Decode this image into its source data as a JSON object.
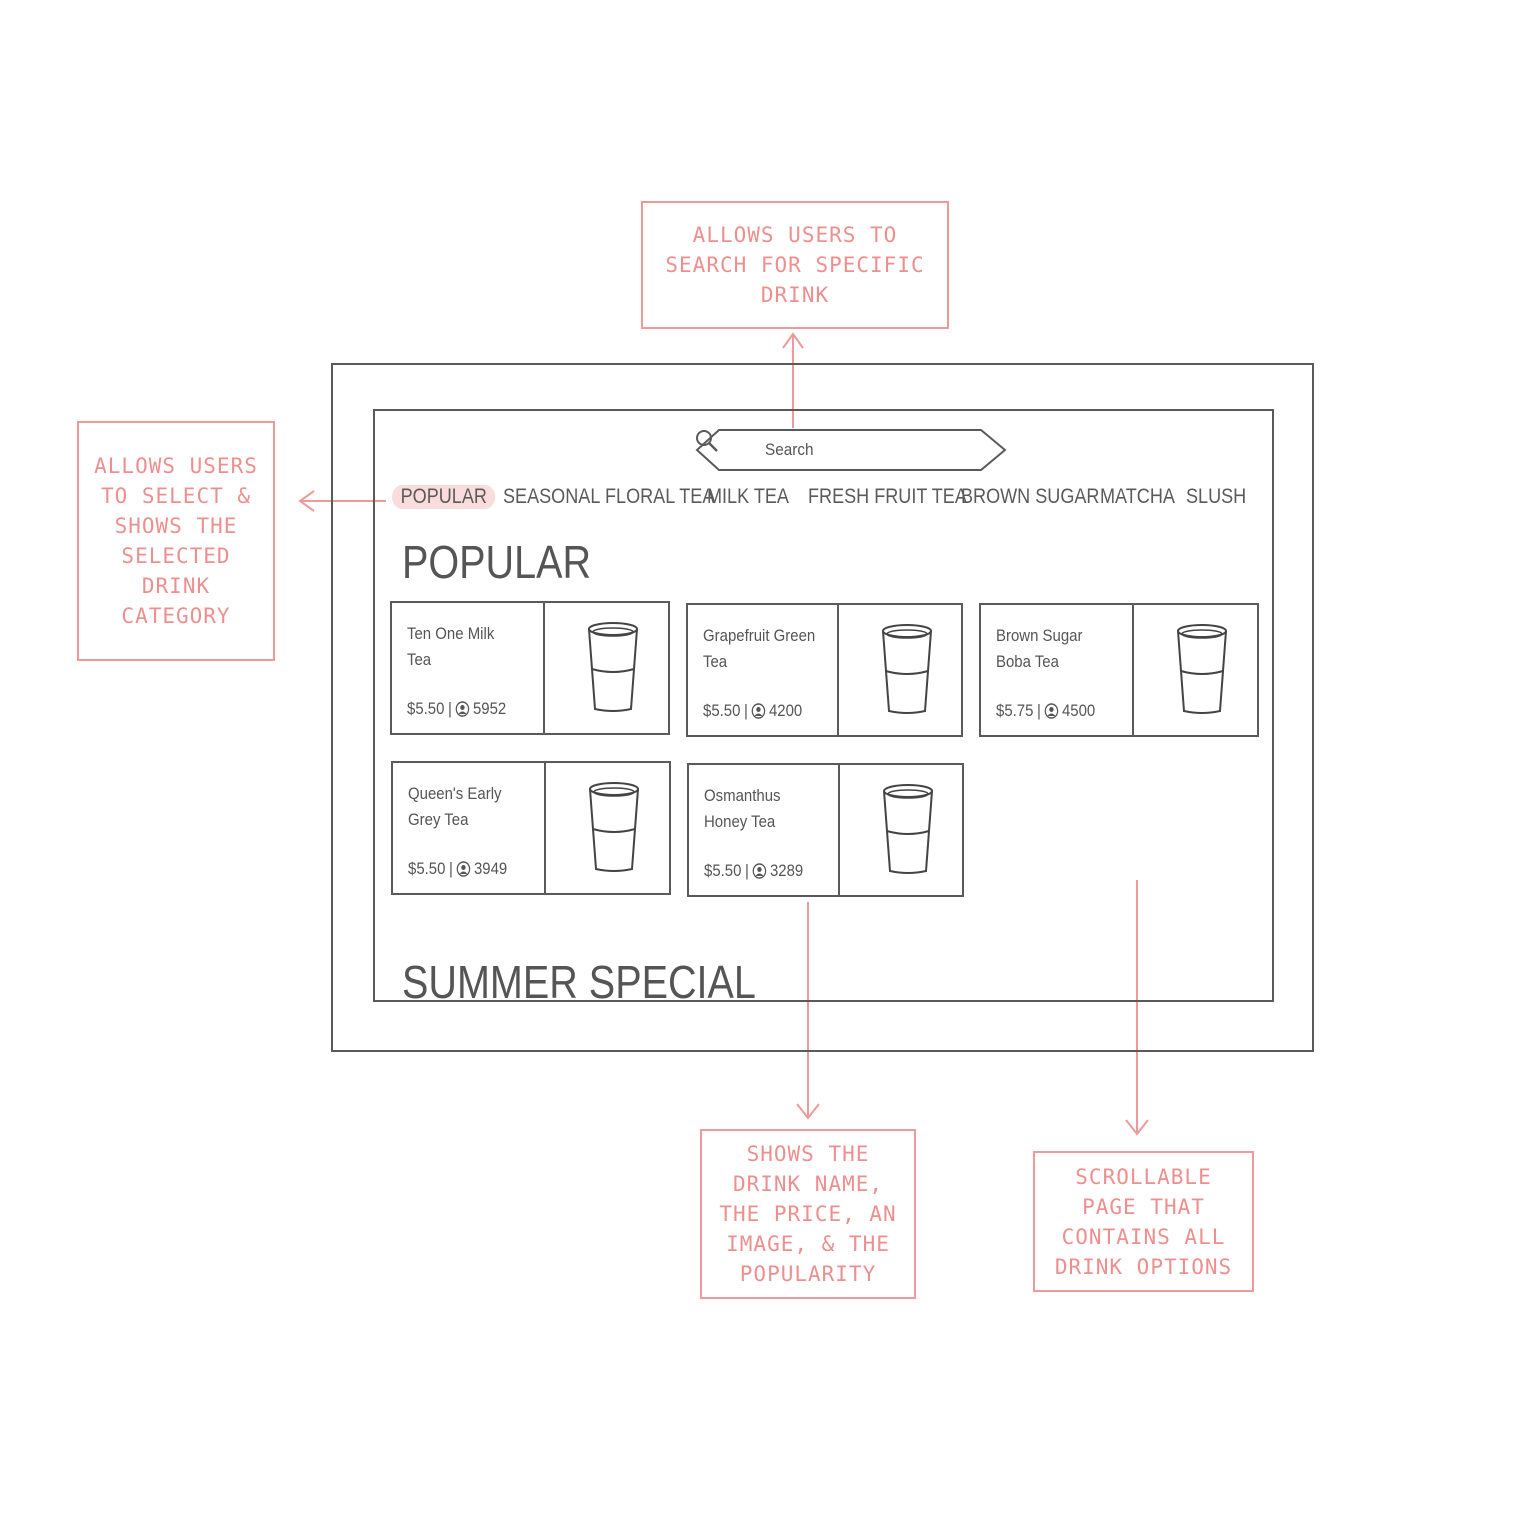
{
  "search": {
    "placeholder": "Search"
  },
  "tabs": [
    {
      "label": "POPULAR",
      "active": true
    },
    {
      "label": "SEASONAL",
      "active": false
    },
    {
      "label": "FLORAL TEA",
      "active": false
    },
    {
      "label": "MILK TEA",
      "active": false
    },
    {
      "label": "FRESH FRUIT TEA",
      "active": false
    },
    {
      "label": "BROWN SUGAR",
      "active": false
    },
    {
      "label": "MATCHA",
      "active": false
    },
    {
      "label": "SLUSH",
      "active": false
    }
  ],
  "sections": {
    "popular": "POPULAR",
    "summer": "SUMMER SPECIAL"
  },
  "drinks": [
    {
      "name": "Ten One Milk Tea",
      "price": "$5.50",
      "popularity": "5952"
    },
    {
      "name": "Grapefruit Green Tea",
      "price": "$5.50",
      "popularity": "4200"
    },
    {
      "name": "Brown Sugar Boba Tea",
      "price": "$5.75",
      "popularity": "4500"
    },
    {
      "name": "Queen's Early Grey Tea",
      "price": "$5.50",
      "popularity": "3949"
    },
    {
      "name": "Osmanthus Honey Tea",
      "price": "$5.50",
      "popularity": "3289"
    }
  ],
  "annotations": {
    "search": "Allows users to search for specific drink",
    "category": "Allows users to select & shows the selected drink category",
    "card": "Shows the drink name, the price, an image, & the popularity",
    "scroll": "Scrollable page that contains all drink options"
  },
  "colors": {
    "annotation": "#ee9a9a",
    "active_tab_bg": "#fbdcdc",
    "wireframe": "#5a5a5a"
  }
}
